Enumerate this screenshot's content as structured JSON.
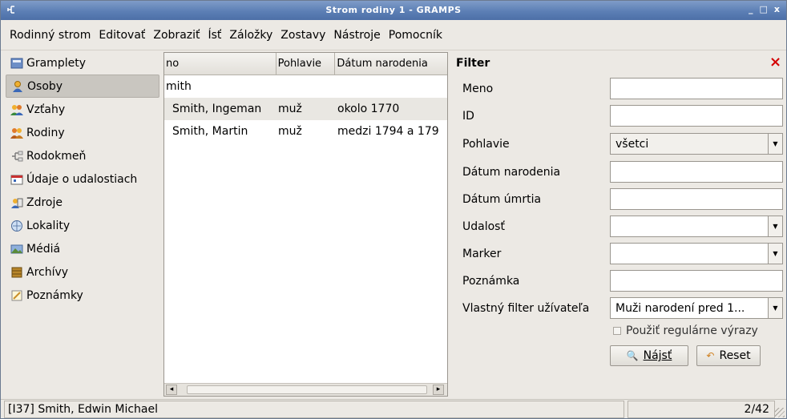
{
  "window": {
    "title": "Strom rodiny 1 - GRAMPS",
    "controls": [
      "_",
      "□",
      "x"
    ]
  },
  "menu": [
    "Rodinný strom",
    "Editovať",
    "Zobraziť",
    "Ísť",
    "Záložky",
    "Zostavy",
    "Nástroje",
    "Pomocník"
  ],
  "sidebar": {
    "active_index": 1,
    "items": [
      {
        "label": "Gramplety",
        "icon": "gramplet-icon"
      },
      {
        "label": "Osoby",
        "icon": "person-icon"
      },
      {
        "label": "Vzťahy",
        "icon": "relationships-icon"
      },
      {
        "label": "Rodiny",
        "icon": "families-icon"
      },
      {
        "label": "Rodokmeň",
        "icon": "pedigree-icon"
      },
      {
        "label": "Údaje o udalostiach",
        "icon": "events-icon"
      },
      {
        "label": "Zdroje",
        "icon": "sources-icon"
      },
      {
        "label": "Lokality",
        "icon": "places-icon"
      },
      {
        "label": "Médiá",
        "icon": "media-icon"
      },
      {
        "label": "Archívy",
        "icon": "repositories-icon"
      },
      {
        "label": "Poznámky",
        "icon": "notes-icon"
      }
    ]
  },
  "people_list": {
    "columns": [
      "no",
      "Pohlavie",
      "Dátum narodenia"
    ],
    "group_label": "mith",
    "rows": [
      {
        "name": "Smith, Ingeman",
        "gender": "muž",
        "birth": "okolo 1770"
      },
      {
        "name": "Smith, Martin",
        "gender": "muž",
        "birth": "medzi 1794 a 179"
      }
    ],
    "selected_row": 0
  },
  "filter": {
    "title": "Filter",
    "fields": {
      "name": {
        "label": "Meno",
        "value": ""
      },
      "id": {
        "label": "ID",
        "value": ""
      },
      "gender": {
        "label": "Pohlavie",
        "value": "všetci"
      },
      "birth": {
        "label": "Dátum narodenia",
        "value": ""
      },
      "death": {
        "label": "Dátum úmrtia",
        "value": ""
      },
      "event": {
        "label": "Udalosť",
        "value": ""
      },
      "marker": {
        "label": "Marker",
        "value": ""
      },
      "note": {
        "label": "Poznámka",
        "value": ""
      },
      "custom": {
        "label": "Vlastný filter užívateľa",
        "value": "Muži narodení pred 1..."
      }
    },
    "regex_label": "Použiť regulárne výrazy",
    "regex_checked": false,
    "find_button": "Nájsť",
    "reset_button": "Reset"
  },
  "status": {
    "text": "[I37] Smith, Edwin Michael",
    "count": "2/42"
  }
}
